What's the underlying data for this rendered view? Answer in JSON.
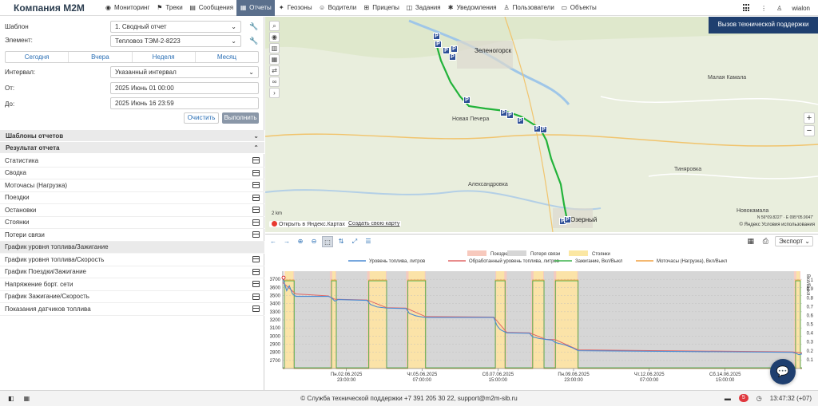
{
  "app": {
    "brand": "Компания M2M",
    "user": "wialon"
  },
  "menu": [
    {
      "label": "Мониторинг",
      "icon": "◉",
      "active": false
    },
    {
      "label": "Треки",
      "icon": "⚑",
      "active": false
    },
    {
      "label": "Сообщения",
      "icon": "▤",
      "active": false
    },
    {
      "label": "Отчеты",
      "icon": "▦",
      "active": true
    },
    {
      "label": "Геозоны",
      "icon": "✦",
      "active": false
    },
    {
      "label": "Водители",
      "icon": "☺",
      "active": false
    },
    {
      "label": "Прицепы",
      "icon": "⊞",
      "active": false
    },
    {
      "label": "Задания",
      "icon": "◫",
      "active": false
    },
    {
      "label": "Уведомления",
      "icon": "✱",
      "active": false
    },
    {
      "label": "Пользователи",
      "icon": "♙",
      "active": false
    },
    {
      "label": "Объекты",
      "icon": "▭",
      "active": false
    }
  ],
  "form": {
    "template_label": "Шаблон",
    "template_value": "1. Сводный отчет",
    "element_label": "Элемент:",
    "element_value": "Тепловоз ТЭМ-2-8223",
    "periods": [
      "Сегодня",
      "Вчера",
      "Неделя",
      "Месяц"
    ],
    "interval_label": "Интервал:",
    "interval_value": "Указанный интервал",
    "from_label": "От:",
    "from_value": "2025 Июнь 01 00:00",
    "to_label": "До:",
    "to_value": "2025 Июнь 16 23:59",
    "clear_label": "Очистить",
    "run_label": "Выполнить"
  },
  "sections": {
    "templates": "Шаблоны отчетов",
    "result": "Результат отчета"
  },
  "result_items": [
    {
      "label": "Статистика",
      "grey": false,
      "icon": true
    },
    {
      "label": "Сводка",
      "grey": false,
      "icon": true
    },
    {
      "label": "Моточасы (Нагрузка)",
      "grey": false,
      "icon": true
    },
    {
      "label": "Поездки",
      "grey": false,
      "icon": true
    },
    {
      "label": "Остановки",
      "grey": false,
      "icon": true
    },
    {
      "label": "Стоянки",
      "grey": false,
      "icon": true
    },
    {
      "label": "Потери связи",
      "grey": false,
      "icon": true
    },
    {
      "label": "График уровня топлива/Зажигание",
      "grey": true,
      "icon": false
    },
    {
      "label": "График уровня топлива/Скорость",
      "grey": false,
      "icon": true
    },
    {
      "label": "График Поездки/Зажигание",
      "grey": false,
      "icon": true
    },
    {
      "label": "Напряжение борт. сети",
      "grey": false,
      "icon": true
    },
    {
      "label": "График Зажигание/Скорость",
      "grey": false,
      "icon": true
    },
    {
      "label": "Показания датчиков топлива",
      "grey": false,
      "icon": true
    }
  ],
  "map": {
    "support_button": "Вызов технической поддержки",
    "cities": [
      {
        "name": "Зеленогорск",
        "big": true
      },
      {
        "name": "Новая Печера",
        "big": false
      },
      {
        "name": "Александровка",
        "big": false
      },
      {
        "name": "Малая Камала",
        "big": false
      },
      {
        "name": "Тиняровка",
        "big": false
      },
      {
        "name": "Новокамала",
        "big": false
      },
      {
        "name": "Озерный",
        "big": true
      }
    ],
    "scale": "2 km",
    "yandex_link": "Открыть в Яндекс.Картах",
    "create_link": "Создать свою карту",
    "copyright": "© Яндекс Условия использования",
    "coords": "N 56°09.8227' · E 095°05.9047'"
  },
  "chart_toolbar": {
    "export_label": "Экспорт"
  },
  "footer": {
    "text": "© Служба технической поддержки +7 391 205 30 22, support@m2m-sib.ru",
    "notifications": "5",
    "time": "13:47:32 (+07)"
  },
  "colors": {
    "accent": "#5a6f8c",
    "support": "#1f3f6f",
    "trips": "#f7c9bd",
    "lost": "#d6d6d6",
    "parkings": "#fbe7a3",
    "fuel": "#4a8ad4",
    "fuel_processed": "#e06666",
    "ignition": "#3cb44b",
    "motohours": "#f0a040"
  },
  "chart_data": {
    "type": "line",
    "legend": {
      "bands": [
        "Поездки",
        "Потеря связи",
        "Стоянки"
      ],
      "series": [
        "Уровень топлива, литров",
        "Обработанный уровень топлива, литров",
        "Зажигание, Вкл/Выкл",
        "Моточасы (Нагрузка), Вкл/Выкл"
      ]
    },
    "ylim_left": [
      2600,
      3800
    ],
    "yticks_left": [
      3700,
      3600,
      3500,
      3400,
      3300,
      3200,
      3100,
      3000,
      2900,
      2800,
      2700
    ],
    "ylim_right": [
      0,
      1.1
    ],
    "yticks_right": [
      "1",
      "0.9",
      "0.8",
      "0.7",
      "0.6",
      "0.5",
      "0.4",
      "0.3",
      "0.2",
      "0.1"
    ],
    "ylabel_right": "Вкл/Выкл",
    "xrange_days": [
      0,
      16
    ],
    "x_ticks": [
      {
        "day": 1.96,
        "label": "Пн.02.06.2025",
        "sub": "23:00:00"
      },
      {
        "day": 4.29,
        "label": "Чт.05.06.2025",
        "sub": "07:00:00"
      },
      {
        "day": 6.63,
        "label": "Сб.07.06.2025",
        "sub": "15:00:00"
      },
      {
        "day": 8.96,
        "label": "Пн.09.06.2025",
        "sub": "23:00:00"
      },
      {
        "day": 11.29,
        "label": "Чт.12.06.2025",
        "sub": "07:00:00"
      },
      {
        "day": 13.63,
        "label": "Сб.14.06.2025",
        "sub": "15:00:00"
      }
    ],
    "trips_intervals": [
      [
        0.05,
        0.35
      ],
      [
        1.45,
        1.65
      ],
      [
        2.6,
        3.2
      ],
      [
        3.8,
        4.4
      ],
      [
        6.55,
        6.9
      ],
      [
        7.65,
        8.05
      ],
      [
        8.35,
        9.1
      ],
      [
        15.75,
        15.95
      ]
    ],
    "lost_interval": [
      0.35,
      15.75
    ],
    "parking_intervals": [
      [
        0.35,
        1.45
      ],
      [
        1.65,
        2.6
      ],
      [
        3.2,
        3.8
      ],
      [
        4.4,
        6.55
      ],
      [
        6.9,
        7.65
      ],
      [
        8.05,
        8.35
      ],
      [
        9.1,
        15.75
      ]
    ],
    "ignition_intervals": [
      [
        0.05,
        0.35
      ],
      [
        1.5,
        1.65
      ],
      [
        2.65,
        3.2
      ],
      [
        3.85,
        4.4
      ],
      [
        6.55,
        6.85
      ],
      [
        7.7,
        8.05
      ],
      [
        8.4,
        9.1
      ],
      [
        15.8,
        15.95
      ]
    ],
    "fuel": {
      "x": [
        0.0,
        0.05,
        0.12,
        0.2,
        0.3,
        0.4,
        1.4,
        1.5,
        1.6,
        1.7,
        2.6,
        2.7,
        2.9,
        3.1,
        3.2,
        3.8,
        3.9,
        4.1,
        4.3,
        4.4,
        6.5,
        6.6,
        6.7,
        6.8,
        6.9,
        7.6,
        7.7,
        7.9,
        8.1,
        8.3,
        8.4,
        8.7,
        8.9,
        9.1,
        15.7,
        15.8,
        15.9,
        16.0
      ],
      "y": [
        3720,
        3650,
        3560,
        3620,
        3520,
        3490,
        3490,
        3475,
        3430,
        3450,
        3440,
        3390,
        3360,
        3350,
        3345,
        3340,
        3280,
        3250,
        3235,
        3230,
        3230,
        3130,
        3080,
        3060,
        3040,
        3035,
        2990,
        2970,
        2960,
        2950,
        2920,
        2890,
        2860,
        2820,
        2800,
        2790,
        2770,
        2780
      ]
    },
    "fuel_processed": {
      "x": [
        0.0,
        0.4,
        1.4,
        1.6,
        2.6,
        3.2,
        3.8,
        4.4,
        6.5,
        6.9,
        7.6,
        8.1,
        8.4,
        9.1,
        15.7,
        16.0
      ],
      "y": [
        3660,
        3520,
        3495,
        3455,
        3445,
        3350,
        3345,
        3240,
        3235,
        3045,
        3040,
        2960,
        2955,
        2830,
        2805,
        2790
      ]
    }
  }
}
